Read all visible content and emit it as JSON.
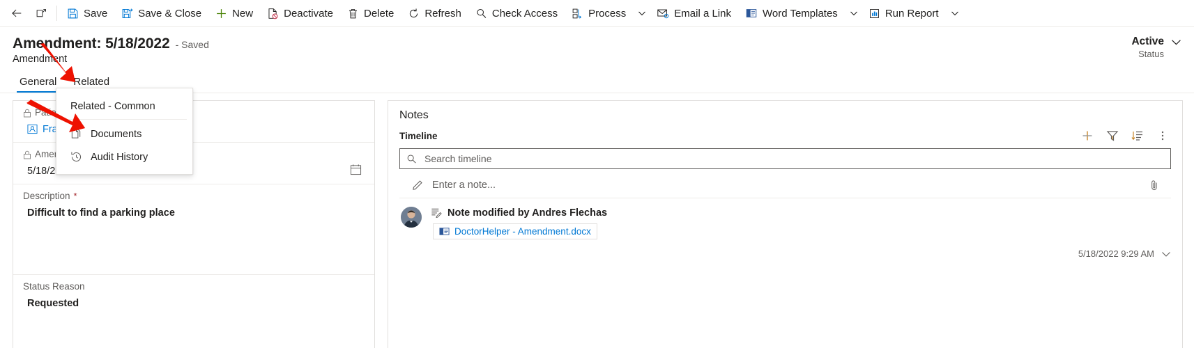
{
  "commandbar": {
    "back_label": "Back",
    "popout_label": "Open in new window",
    "items": [
      {
        "id": "save",
        "label": "Save",
        "icon": "save-icon",
        "chevron": false
      },
      {
        "id": "save-close",
        "label": "Save & Close",
        "icon": "save-close-icon",
        "chevron": false
      },
      {
        "id": "new",
        "label": "New",
        "icon": "plus-icon",
        "chevron": false
      },
      {
        "id": "deactivate",
        "label": "Deactivate",
        "icon": "deactivate-icon",
        "chevron": false
      },
      {
        "id": "delete",
        "label": "Delete",
        "icon": "trash-icon",
        "chevron": false
      },
      {
        "id": "refresh",
        "label": "Refresh",
        "icon": "refresh-icon",
        "chevron": false
      },
      {
        "id": "check-access",
        "label": "Check Access",
        "icon": "magnifier-icon",
        "chevron": false
      },
      {
        "id": "process",
        "label": "Process",
        "icon": "process-icon",
        "chevron": true
      },
      {
        "id": "email-a-link",
        "label": "Email a Link",
        "icon": "email-icon",
        "chevron": false
      },
      {
        "id": "word-templates",
        "label": "Word Templates",
        "icon": "word-icon",
        "chevron": true
      },
      {
        "id": "run-report",
        "label": "Run Report",
        "icon": "report-icon",
        "chevron": true
      }
    ]
  },
  "header": {
    "title": "Amendment: 5/18/2022",
    "saved_state": "- Saved",
    "entity": "Amendment",
    "status_value": "Active",
    "status_label": "Status"
  },
  "tabs": [
    {
      "id": "general",
      "label": "General",
      "active": true
    },
    {
      "id": "related",
      "label": "Related",
      "active": false
    }
  ],
  "flyout": {
    "header": "Related - Common",
    "items": [
      {
        "id": "documents",
        "label": "Documents",
        "icon": "documents-icon"
      },
      {
        "id": "audit-history",
        "label": "Audit History",
        "icon": "history-icon"
      }
    ]
  },
  "form": {
    "fields": [
      {
        "id": "patient",
        "label": "Patient",
        "locked": true,
        "required": false,
        "value": "Frank Martinez",
        "type": "lookup"
      },
      {
        "id": "amendment-date",
        "label": "Amendment Date",
        "locked": true,
        "required": false,
        "value": "5/18/2022",
        "type": "date"
      },
      {
        "id": "description",
        "label": "Description",
        "locked": false,
        "required": true,
        "value": "Difficult to find a parking place",
        "type": "multiline"
      },
      {
        "id": "status-reason",
        "label": "Status Reason",
        "locked": false,
        "required": false,
        "value": "Requested",
        "type": "choice"
      }
    ]
  },
  "notes": {
    "section_title": "Notes",
    "timeline_label": "Timeline",
    "actions": [
      {
        "id": "create-record",
        "icon": "plus-icon",
        "label": "Create a timeline record"
      },
      {
        "id": "filter",
        "icon": "filter-icon",
        "label": "Filter timeline"
      },
      {
        "id": "sort",
        "icon": "sort-icon",
        "label": "Sort timeline"
      },
      {
        "id": "more",
        "icon": "more-vertical-icon",
        "label": "More commands"
      }
    ],
    "search_placeholder": "Search timeline",
    "search_value": "",
    "note_entry_placeholder": "Enter a note...",
    "attach_label": "Attach a file",
    "items": [
      {
        "id": "note-1",
        "headline": "Note modified by Andres Flechas",
        "attachment": "DoctorHelper - Amendment.docx",
        "timestamp": "5/18/2022 9:29 AM"
      }
    ]
  },
  "colors": {
    "accent": "#0078d4",
    "link": "#0f6cbd",
    "required": "#a4262c",
    "annotation": "#ee1100",
    "save_icon": "#0078d4",
    "new_icon": "#498205",
    "border": "#e1dfdd"
  }
}
